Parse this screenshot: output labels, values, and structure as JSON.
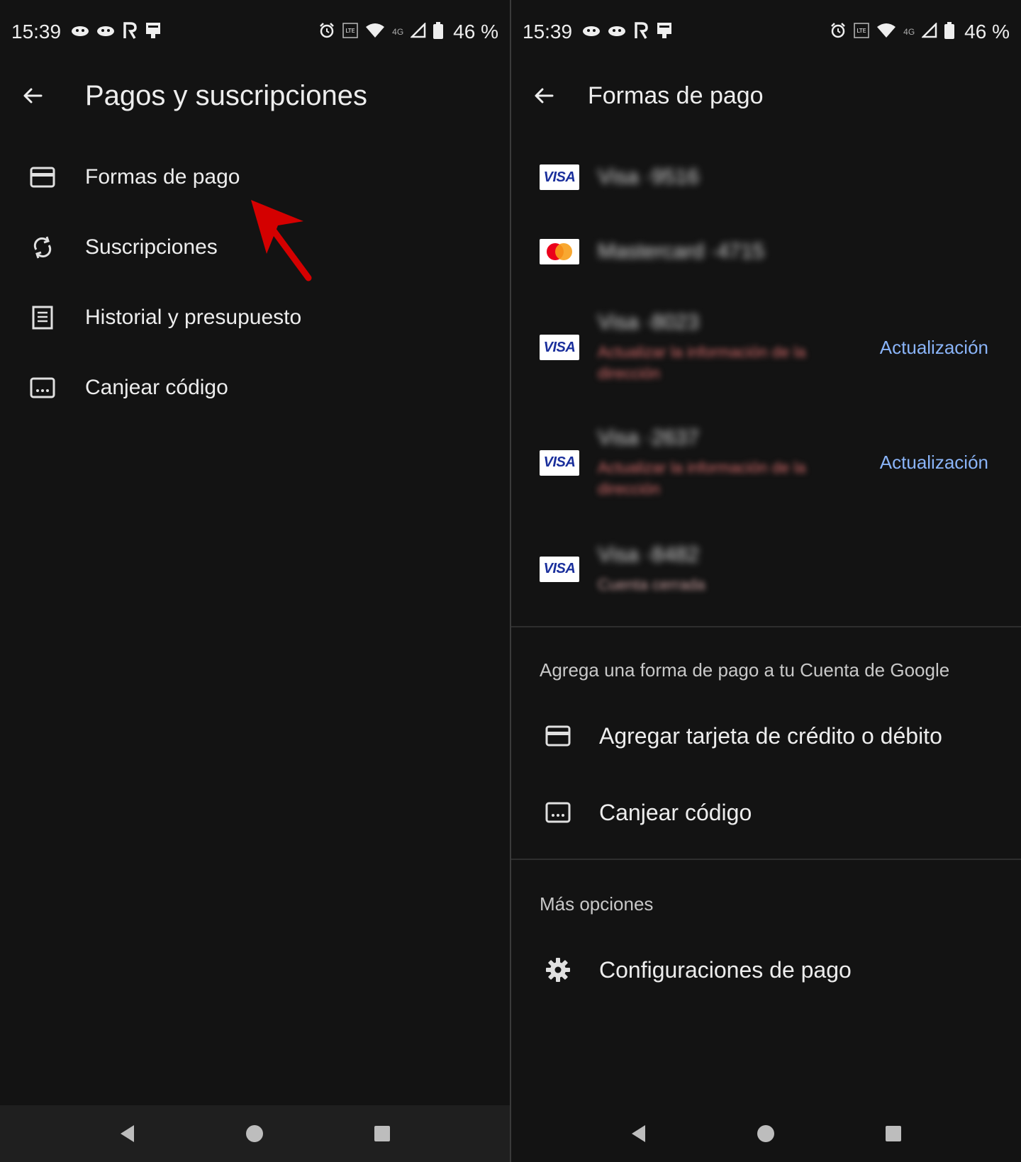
{
  "status_bar": {
    "time": "15:39",
    "battery": "46 %",
    "network_small": "4G",
    "left_icons": [
      "ghost-icon",
      "ghost-icon",
      "app-r-icon",
      "download-icon"
    ],
    "right_icons": [
      "alarm-icon",
      "volte-icon",
      "wifi-icon",
      "signal-icon",
      "battery-icon"
    ]
  },
  "left_screen": {
    "title": "Pagos y suscripciones",
    "menu": [
      {
        "label": "Formas de pago",
        "icon": "credit-card-icon"
      },
      {
        "label": "Suscripciones",
        "icon": "sync-icon"
      },
      {
        "label": "Historial y presupuesto",
        "icon": "receipt-icon"
      },
      {
        "label": "Canjear código",
        "icon": "redeem-code-icon"
      }
    ],
    "annotation": {
      "type": "red-arrow",
      "target": "Formas de pago",
      "color": "#d40000"
    }
  },
  "right_screen": {
    "title": "Formas de pago",
    "payment_methods": [
      {
        "brand": "VISA",
        "name": "Visa ·9516",
        "subtitle": "",
        "action": ""
      },
      {
        "brand": "Mastercard",
        "name": "Mastercard ·4715",
        "subtitle": "",
        "action": ""
      },
      {
        "brand": "VISA",
        "name": "Visa ·8023",
        "subtitle": "Actualizar la información de la dirección",
        "action": "Actualización"
      },
      {
        "brand": "VISA",
        "name": "Visa ·2637",
        "subtitle": "Actualizar la información de la dirección",
        "action": "Actualización"
      },
      {
        "brand": "VISA",
        "name": "Visa ·8482",
        "subtitle": "Cuenta cerrada",
        "action": ""
      }
    ],
    "add_section_caption": "Agrega una forma de pago a tu Cuenta de Google",
    "add_card_label": "Agregar tarjeta de crédito o débito",
    "redeem_label": "Canjear código",
    "more_options_caption": "Más opciones",
    "settings_label": "Configuraciones de pago"
  },
  "colors": {
    "background": "#131313",
    "text": "#ededed",
    "link": "#8ab4f8",
    "error_text": "#d36a6a",
    "arrow": "#d40000"
  },
  "nav_bar": {
    "buttons": [
      "back-triangle-icon",
      "home-circle-icon",
      "recents-square-icon"
    ]
  }
}
